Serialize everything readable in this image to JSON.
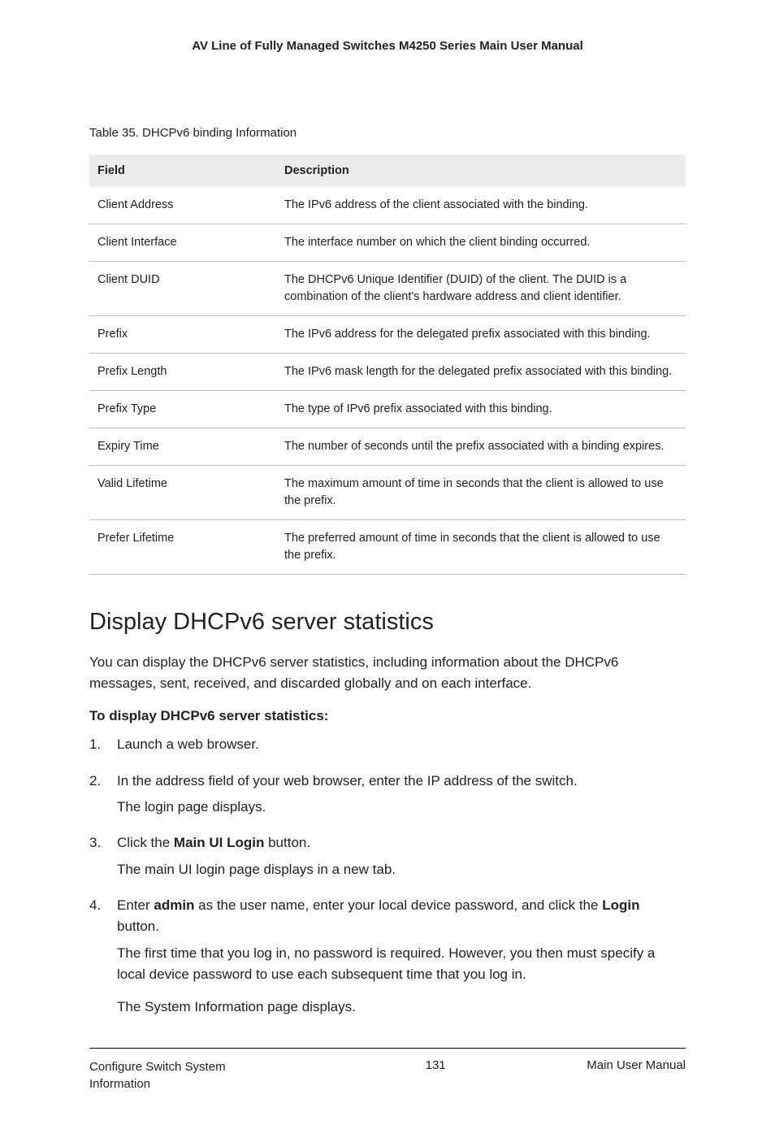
{
  "header": {
    "title": "AV Line of Fully Managed Switches M4250 Series Main User Manual"
  },
  "table": {
    "caption": "Table 35. DHCPv6 binding Information",
    "headers": {
      "field": "Field",
      "description": "Description"
    },
    "rows": [
      {
        "field": "Client Address",
        "desc": "The IPv6 address of the client associated with the binding."
      },
      {
        "field": "Client Interface",
        "desc": "The interface number on which the client binding occurred."
      },
      {
        "field": "Client DUID",
        "desc": "The DHCPv6 Unique Identifier (DUID) of the client. The DUID is a combination of the client's hardware address and client identifier."
      },
      {
        "field": "Prefix",
        "desc": "The IPv6 address for the delegated prefix associated with this binding."
      },
      {
        "field": "Prefix Length",
        "desc": "The IPv6 mask length for the delegated prefix associated with this binding."
      },
      {
        "field": "Prefix Type",
        "desc": "The type of IPv6 prefix associated with this binding."
      },
      {
        "field": "Expiry Time",
        "desc": "The number of seconds until the prefix associated with a binding expires."
      },
      {
        "field": "Valid Lifetime",
        "desc": "The maximum amount of time in seconds that the client is allowed to use the prefix."
      },
      {
        "field": "Prefer Lifetime",
        "desc": "The preferred amount of time in seconds that the client is allowed to use the prefix."
      }
    ]
  },
  "section": {
    "heading": "Display DHCPv6 server statistics",
    "intro": "You can display the DHCPv6 server statistics, including information about the DHCPv6 messages, sent, received, and discarded globally and on each interface.",
    "procedure_title": "To display DHCPv6 server statistics:",
    "steps": {
      "s1": "Launch a web browser.",
      "s2a": "In the address field of your web browser, enter the IP address of the switch.",
      "s2b": "The login page displays.",
      "s3_pre": "Click the ",
      "s3_bold": "Main UI Login",
      "s3_post": " button.",
      "s3b": "The main UI login page displays in a new tab.",
      "s4_pre": "Enter ",
      "s4_bold1": "admin",
      "s4_mid": " as the user name, enter your local device password, and click the ",
      "s4_bold2": "Login",
      "s4_post": " button.",
      "s4b": "The first time that you log in, no password is required. However, you then must specify a local device password to use each subsequent time that you log in.",
      "s4c": "The System Information page displays."
    }
  },
  "footer": {
    "left": "Configure Switch System Information",
    "center": "131",
    "right": "Main User Manual"
  }
}
